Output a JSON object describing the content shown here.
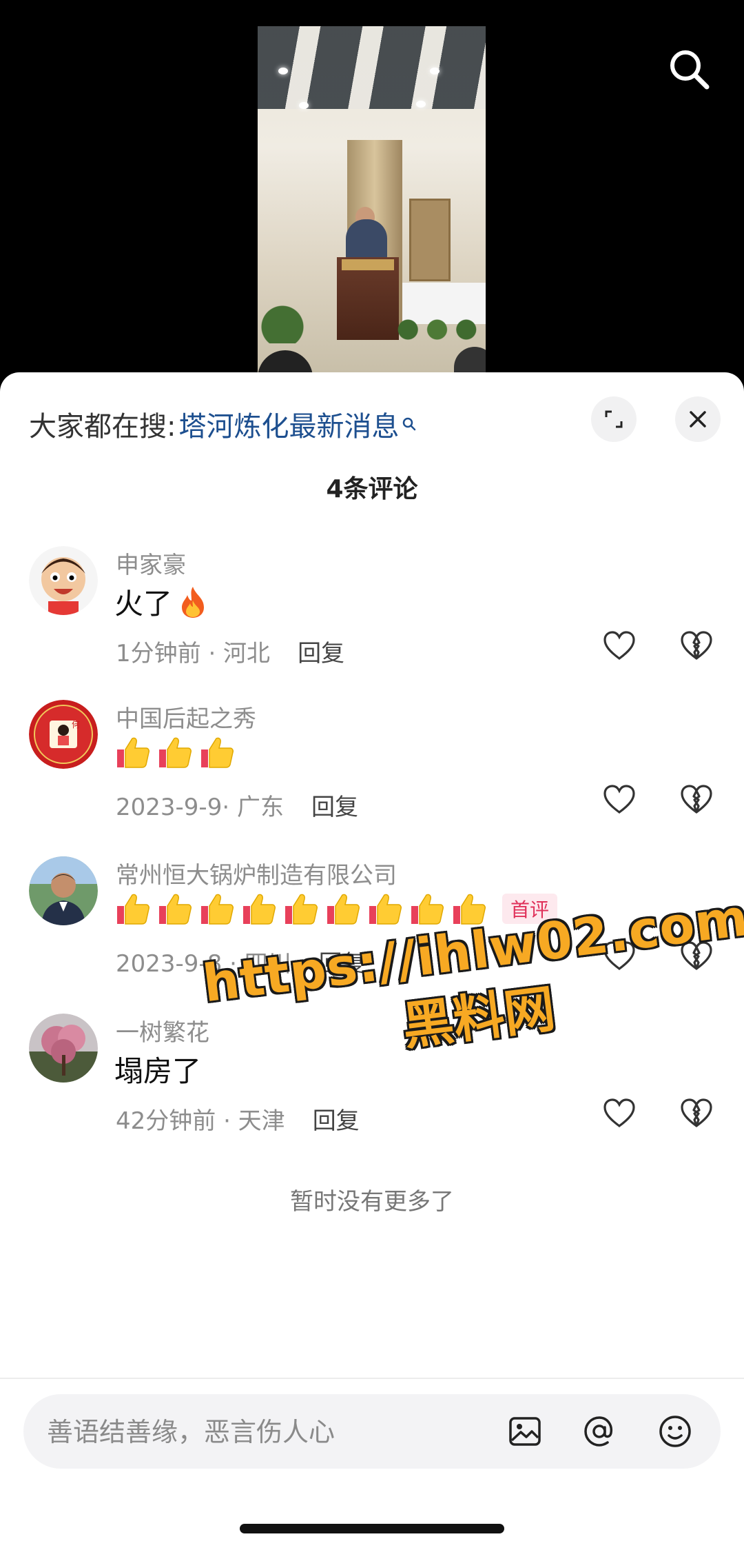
{
  "hot_search": {
    "prefix": "大家都在搜:",
    "keyword": "塔河炼化最新消息"
  },
  "comment_count": "4条评论",
  "comments": [
    {
      "user": "申家豪",
      "text": "火了",
      "time": "1分钟前 · 河北",
      "reply": "回复",
      "emoji": "fire"
    },
    {
      "user": "中国后起之秀",
      "text": "",
      "time": "2023-9-9· 广东",
      "reply": "回复",
      "emoji": "thumbs-up x3"
    },
    {
      "user": "常州恒大锅炉制造有限公司",
      "text": "",
      "time": "2023-9-8 · 四川",
      "reply": "回复",
      "emoji": "thumbs-up x9",
      "badge": "首评"
    },
    {
      "user": "一树繁花",
      "text": "塌房了",
      "time": "42分钟前 · 天津",
      "reply": "回复"
    }
  ],
  "no_more": "暂时没有更多了",
  "input": {
    "placeholder": "善语结善缘，恶言伤人心"
  },
  "watermark": {
    "url": "https://ihlw02.com",
    "name": "黑料网"
  },
  "colors": {
    "keyword": "#1d4f8f",
    "badge": "#e0315a",
    "watermark": "#f7a923"
  }
}
